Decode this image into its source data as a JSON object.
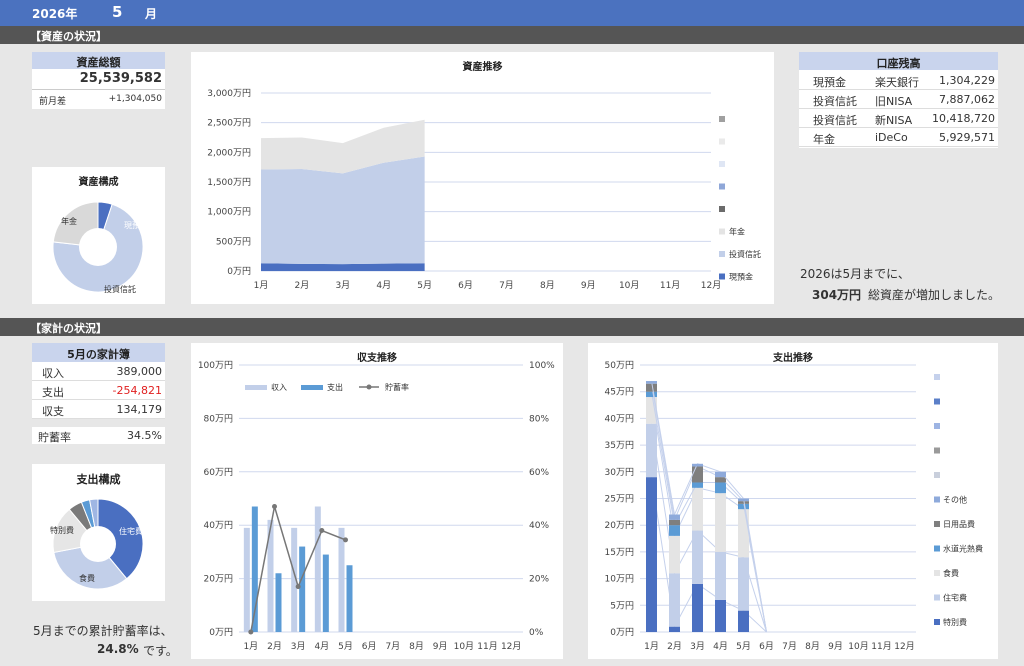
{
  "header": {
    "year": "2026年",
    "month": "5",
    "month_suffix": "月"
  },
  "section1": {
    "title": "【資産の状況】"
  },
  "section2": {
    "title": "【家計の状況】"
  },
  "total_assets": {
    "label": "資産総額",
    "value": "25,539,582",
    "diff_label": "前月差",
    "diff_value": "+1,304,050"
  },
  "asset_composition": {
    "title": "資産構成",
    "labels": [
      "現預金",
      "年金",
      "投資信託"
    ]
  },
  "accounts": {
    "title": "口座残高",
    "rows": [
      {
        "type": "現預金",
        "name": "楽天銀行",
        "value": "1,304,229"
      },
      {
        "type": "投資信託",
        "name": "旧NISA",
        "value": "7,887,062"
      },
      {
        "type": "投資信託",
        "name": "新NISA",
        "value": "10,418,720"
      },
      {
        "type": "年金",
        "name": "iDeCo",
        "value": "5,929,571"
      }
    ]
  },
  "asset_summary": {
    "line1": "2026は5月までに、",
    "amount": "304万円",
    "line2": "総資産が増加しました。"
  },
  "household": {
    "title": "5月の家計簿",
    "rows": [
      {
        "label": "収入",
        "value": "389,000"
      },
      {
        "label": "支出",
        "value": "-254,821"
      },
      {
        "label": "収支",
        "value": "134,179"
      }
    ],
    "rate_label": "貯蓄率",
    "rate_value": "34.5%"
  },
  "expense_composition": {
    "title": "支出構成",
    "labels": [
      "住宅費",
      "食費",
      "特別費"
    ]
  },
  "savings_summary": {
    "line1": "5月までの累計貯蓄率は、",
    "value": "24.8%",
    "line2": "です。"
  },
  "colors": {
    "blue_dark": "#4a6fc1",
    "blue_light": "#c2cfe9",
    "gray_light": "#e4e4e4",
    "gray_dark": "#7f7f7f",
    "blue_mid": "#5b9bd5",
    "grid": "#d0d8ee"
  },
  "chart_data": [
    {
      "type": "area",
      "title": "資産推移",
      "categories": [
        "1月",
        "2月",
        "3月",
        "4月",
        "5月",
        "6月",
        "7月",
        "8月",
        "9月",
        "10月",
        "11月",
        "12月"
      ],
      "yticks": [
        "0万円",
        "500万円",
        "1,000万円",
        "1,500万円",
        "2,000万円",
        "2,500万円",
        "3,000万円"
      ],
      "ylim": [
        0,
        3000
      ],
      "series": [
        {
          "name": "現預金",
          "values": [
            130,
            120,
            115,
            125,
            130
          ]
        },
        {
          "name": "投資信託",
          "values": [
            1580,
            1600,
            1530,
            1700,
            1800
          ]
        },
        {
          "name": "年金",
          "values": [
            530,
            530,
            510,
            590,
            620
          ]
        }
      ],
      "legend": [
        "",
        "",
        "",
        "",
        "",
        "年金",
        "投資信託",
        "現預金"
      ]
    },
    {
      "type": "pie",
      "title": "資産構成",
      "labels": [
        "現預金",
        "投資信託",
        "年金"
      ],
      "values": [
        5.1,
        71.7,
        23.2
      ]
    },
    {
      "type": "bar",
      "title": "収支推移",
      "categories": [
        "1月",
        "2月",
        "3月",
        "4月",
        "5月",
        "6月",
        "7月",
        "8月",
        "9月",
        "10月",
        "11月",
        "12月"
      ],
      "yticks": [
        "0万円",
        "20万円",
        "40万円",
        "60万円",
        "80万円",
        "100万円"
      ],
      "y2ticks": [
        "0%",
        "20%",
        "40%",
        "60%",
        "80%",
        "100%"
      ],
      "ylim": [
        0,
        100
      ],
      "series": [
        {
          "name": "収入",
          "values": [
            39,
            42,
            39,
            47,
            39
          ]
        },
        {
          "name": "支出",
          "values": [
            47,
            22,
            32,
            29,
            25
          ]
        },
        {
          "name": "貯蓄率",
          "values": [
            0,
            47,
            17,
            38,
            34.5
          ]
        }
      ]
    },
    {
      "type": "pie",
      "title": "支出構成",
      "labels": [
        "住宅費",
        "食費",
        "特別費"
      ],
      "values": [
        39,
        33,
        17,
        5,
        3,
        3
      ]
    },
    {
      "type": "bar",
      "title": "支出推移",
      "categories": [
        "1月",
        "2月",
        "3月",
        "4月",
        "5月",
        "6月",
        "7月",
        "8月",
        "9月",
        "10月",
        "11月",
        "12月"
      ],
      "yticks": [
        "0万円",
        "5万円",
        "10万円",
        "15万円",
        "20万円",
        "25万円",
        "30万円",
        "35万円",
        "40万円",
        "45万円",
        "50万円"
      ],
      "ylim": [
        0,
        50
      ],
      "series": [
        {
          "name": "特別費",
          "values": [
            29,
            1,
            9,
            6,
            4
          ]
        },
        {
          "name": "住宅費",
          "values": [
            10,
            10,
            10,
            9,
            10
          ]
        },
        {
          "name": "食費",
          "values": [
            5,
            7,
            8,
            11,
            9
          ]
        },
        {
          "name": "水道光熱費",
          "values": [
            1,
            2,
            1,
            2,
            1
          ]
        },
        {
          "name": "日用品費",
          "values": [
            1.5,
            1,
            3,
            1,
            0.5
          ]
        },
        {
          "name": "その他",
          "values": [
            0.5,
            1,
            0.5,
            1,
            0.5
          ]
        }
      ],
      "legend": [
        "",
        "",
        "",
        "",
        "",
        "その他",
        "日用品費",
        "水道光熱費",
        "食費",
        "住宅費",
        "特別費"
      ]
    }
  ]
}
